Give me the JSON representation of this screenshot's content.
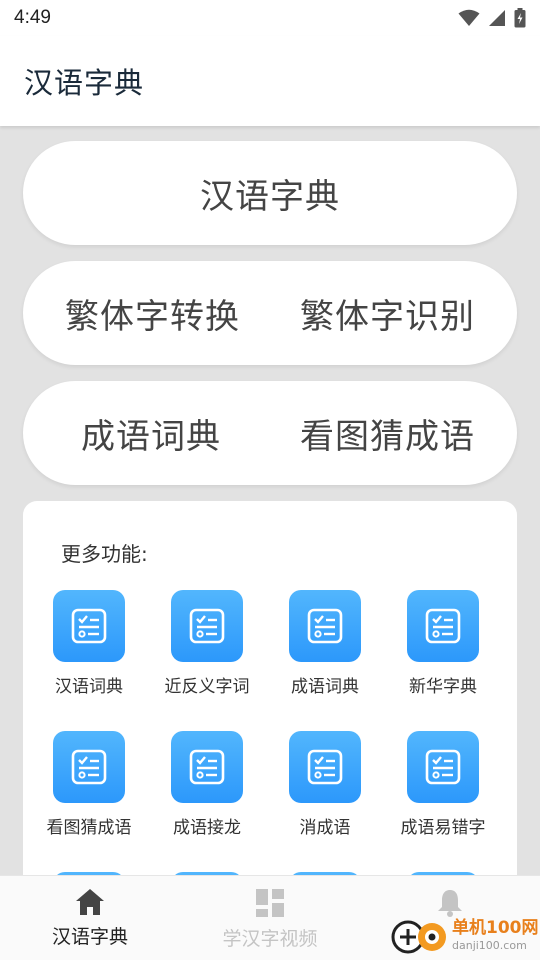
{
  "status_bar": {
    "time": "4:49"
  },
  "app_bar": {
    "title": "汉语字典"
  },
  "buttons": {
    "dictionary": "汉语字典",
    "trad_convert": "繁体字转换",
    "trad_recognize": "繁体字识别",
    "idiom_dict": "成语词典",
    "guess_idiom": "看图猜成语"
  },
  "more": {
    "title": "更多功能:",
    "items": [
      {
        "label": "汉语词典"
      },
      {
        "label": "近反义字词"
      },
      {
        "label": "成语词典"
      },
      {
        "label": "新华字典"
      },
      {
        "label": "看图猜成语"
      },
      {
        "label": "成语接龙"
      },
      {
        "label": "消成语"
      },
      {
        "label": "成语易错字"
      }
    ]
  },
  "bottom_nav": {
    "items": [
      {
        "label": "汉语字典",
        "icon": "home-icon",
        "active": true
      },
      {
        "label": "学汉字视频",
        "icon": "grid-icon",
        "active": false
      },
      {
        "label": "",
        "icon": "bell-icon",
        "active": false
      }
    ]
  },
  "watermark": {
    "main": "单机100网",
    "sub": "danji100.com"
  },
  "colors": {
    "accent_tile": "#3aa6fc",
    "background": "#e2e2e2",
    "watermark": "#e8801c"
  }
}
